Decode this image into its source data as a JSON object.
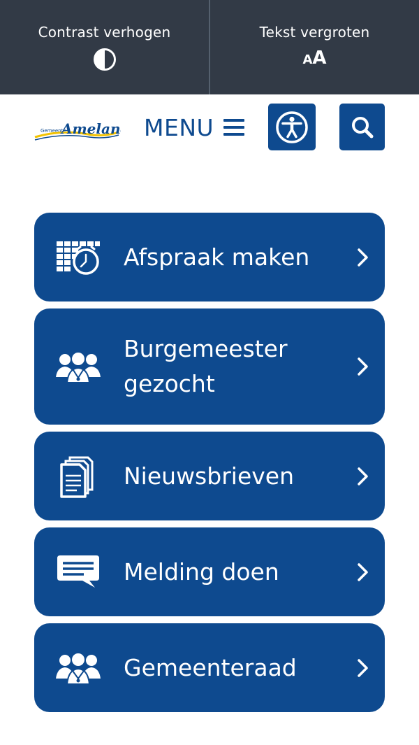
{
  "accessibility_bar": {
    "contrast_label": "Contrast verhogen",
    "text_size_label": "Tekst vergroten",
    "text_size_glyph_small": "A",
    "text_size_glyph_large": "A"
  },
  "header": {
    "logo_small": "Gemeente",
    "logo_main": "Ameland",
    "menu_label": "MENU"
  },
  "quick_links": [
    {
      "label": "Afspraak maken",
      "icon": "calendar-clock-icon"
    },
    {
      "label": "Burgemeester gezocht",
      "icon": "people-icon"
    },
    {
      "label": "Nieuwsbrieven",
      "icon": "documents-icon"
    },
    {
      "label": "Melding doen",
      "icon": "chat-bubble-icon"
    },
    {
      "label": "Gemeenteraad",
      "icon": "council-icon"
    }
  ],
  "colors": {
    "top_bar": "#323a46",
    "brand_blue": "#0e4a8f",
    "logo_yellow": "#f2c200"
  }
}
